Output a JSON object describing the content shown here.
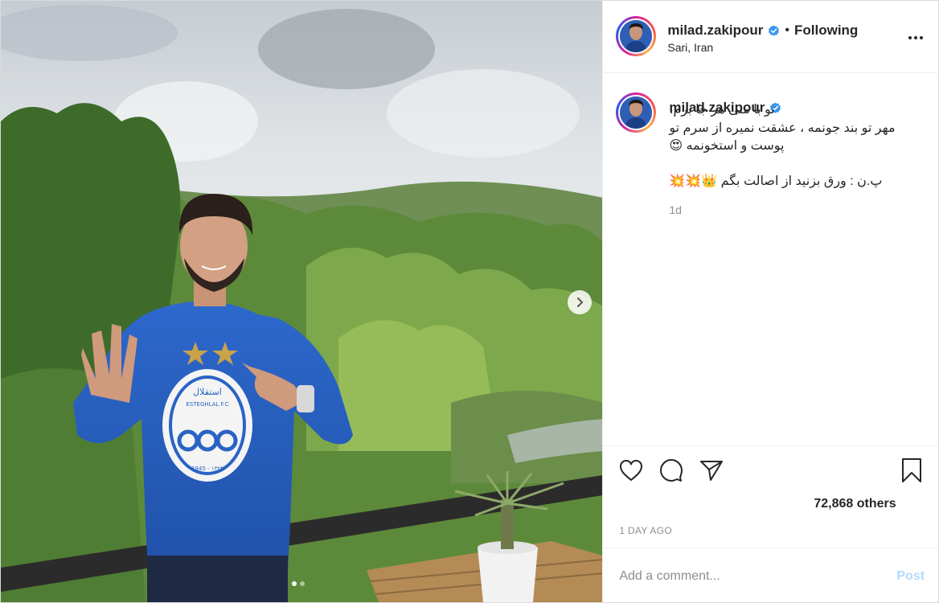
{
  "header": {
    "username": "milad.zakipour",
    "separator": "•",
    "follow_status": "Following",
    "location": "Sari, Iran"
  },
  "caption": {
    "username": "milad.zakipour",
    "lines": [
      "تو با منی هر جا برم،",
      "مهر تو بند جونمه ، عشقت نمیره از سرم تو",
      "پوست و استخونمه 😍",
      "پ.ن : ورق بزنید از اصالت بگم 👑💥💥"
    ],
    "time_ago": "1d"
  },
  "shirt": {
    "club_name": "استقلال",
    "club_name_latin": "ESTEGHLAL F.C",
    "founded": "1945 - ۱۳۲۴"
  },
  "stats": {
    "likes": "72,868 others",
    "posted": "1 DAY AGO"
  },
  "comment": {
    "placeholder": "Add a comment...",
    "post_label": "Post"
  },
  "carousel": {
    "current": 1,
    "total": 2
  },
  "colors": {
    "verified_blue": "#3897f0",
    "post_button_disabled": "#b3dbff",
    "text_primary": "#262626",
    "text_secondary": "#8e8e8e",
    "shirt_blue": "#2a63c4"
  },
  "icons": [
    "verified-badge-icon",
    "more-options-icon",
    "heart-icon",
    "comment-icon",
    "share-icon",
    "bookmark-icon",
    "chevron-right-icon"
  ]
}
